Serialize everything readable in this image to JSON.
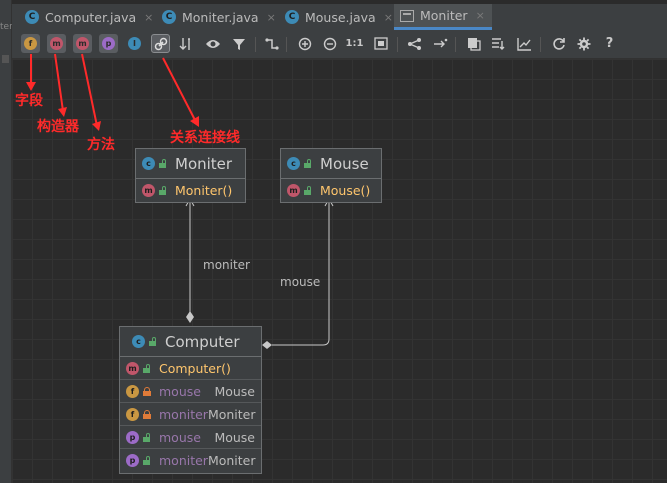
{
  "tabs": [
    {
      "label": "Computer.java",
      "icon": "C"
    },
    {
      "label": "Moniter.java",
      "icon": "C"
    },
    {
      "label": "Mouse.java",
      "icon": "C"
    },
    {
      "label": "Moniter",
      "icon": "diagram"
    }
  ],
  "close_glyph": "×",
  "gutter_text": "ter",
  "toolbar": {
    "fields_letter": "f",
    "constructors_letter": "m",
    "methods_letter": "m",
    "properties_letter": "p",
    "inner_letter": "I",
    "actual_size_label": "1:1",
    "help_label": "?"
  },
  "annotations": {
    "fields": "字段",
    "constructors": "构造器",
    "methods": "方法",
    "relations": "关系连接线"
  },
  "annotation_color": "#ff2a2a",
  "nodes": {
    "moniter": {
      "title": "Moniter",
      "rows": [
        {
          "kind": "m",
          "name": "Moniter()"
        }
      ]
    },
    "mouse": {
      "title": "Mouse",
      "rows": [
        {
          "kind": "m",
          "name": "Mouse()"
        }
      ]
    },
    "computer": {
      "title": "Computer",
      "rows": [
        {
          "kind": "m",
          "name": "Computer()",
          "type": ""
        },
        {
          "kind": "f",
          "name": "mouse",
          "type": "Mouse"
        },
        {
          "kind": "f",
          "name": "moniter",
          "type": "Moniter"
        },
        {
          "kind": "p",
          "name": "mouse",
          "type": "Mouse"
        },
        {
          "kind": "p",
          "name": "moniter",
          "type": "Moniter"
        }
      ]
    }
  },
  "edges": {
    "moniter_label": "moniter",
    "mouse_label": "mouse"
  }
}
